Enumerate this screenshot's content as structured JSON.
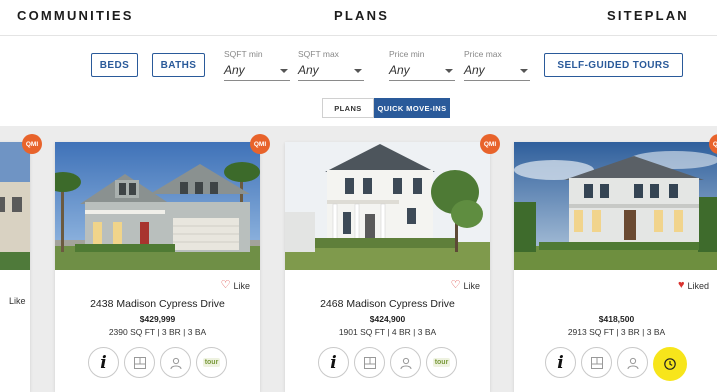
{
  "nav": {
    "communities": "COMMUNITIES",
    "plans": "PLANS",
    "siteplan": "SITEPLAN"
  },
  "filters": {
    "beds": "BEDS",
    "baths": "BATHS",
    "sqft_min_label": "SQFT min",
    "sqft_min_value": "Any",
    "sqft_max_label": "SQFT max",
    "sqft_max_value": "Any",
    "price_min_label": "Price min",
    "price_min_value": "Any",
    "price_max_label": "Price max",
    "price_max_value": "Any",
    "tours": "SELF-GUIDED TOURS"
  },
  "toggle": {
    "plans": "PLANS",
    "qmi": "QUICK MOVE-INS",
    "active": "qmi"
  },
  "badge_text": "QMI",
  "partial_card": {
    "like_label": "Like"
  },
  "cards": [
    {
      "address": "2438 Madison Cypress Drive",
      "price": "$429,999",
      "specs": "2390 SQ FT | 3 BR | 3 BA",
      "like_label": "Like",
      "liked": false,
      "tour_label": "tour"
    },
    {
      "address": "2468 Madison Cypress Drive",
      "price": "$424,900",
      "specs": "1901 SQ FT | 4 BR | 3 BA",
      "like_label": "Like",
      "liked": false,
      "tour_label": "tour"
    },
    {
      "address": "",
      "price": "$418,500",
      "specs": "2913 SQ FT | 3 BR | 3 BA",
      "like_label": "Liked",
      "liked": true
    }
  ],
  "colors": {
    "accent_blue": "#2a5a9a",
    "badge_orange": "#e8632b",
    "heart_red": "#d9322f",
    "highlight_yellow": "#f7e51b"
  }
}
